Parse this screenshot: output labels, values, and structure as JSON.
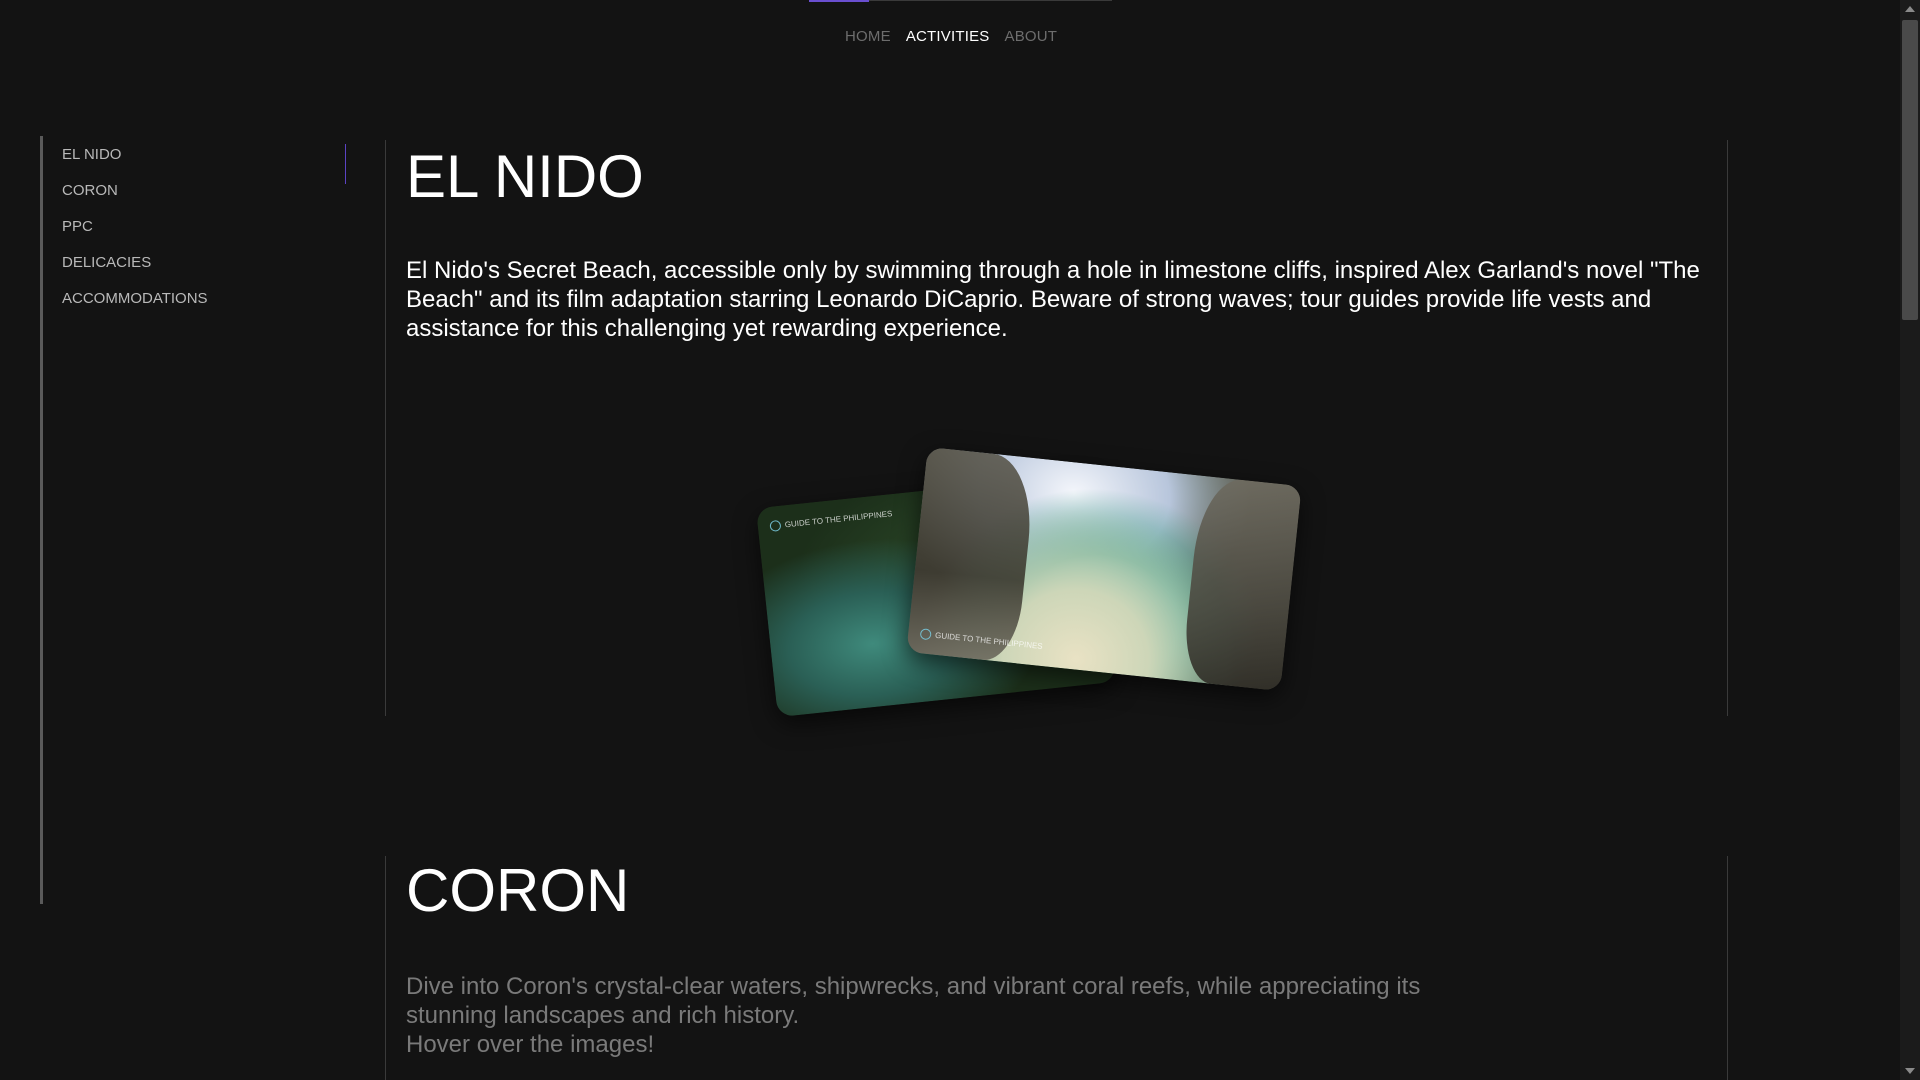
{
  "topnav": {
    "items": [
      {
        "label": "HOME"
      },
      {
        "label": "ACTIVITIES"
      },
      {
        "label": "ABOUT"
      }
    ],
    "active": "ACTIVITIES",
    "colors": {
      "active": "#ffffff",
      "inactive": "#6d6d6d",
      "indicator": "#6a4fd0"
    }
  },
  "sidebar": {
    "items": [
      {
        "label": "EL NIDO"
      },
      {
        "label": "CORON"
      },
      {
        "label": "PPC"
      },
      {
        "label": "DELICACIES"
      },
      {
        "label": "ACCOMMODATIONS"
      }
    ],
    "active": "EL NIDO"
  },
  "sections": {
    "elnido": {
      "title": "EL NIDO",
      "text": "El Nido's Secret Beach, accessible only by swimming through a hole in limestone cliffs, inspired Alex Garland's novel \"The Beach\" and its film adaptation starring Leonardo DiCaprio. Beware of strong waves; tour guides provide life vests and assistance for this challenging yet rewarding experience.",
      "photos": [
        {
          "icon": "lagoon-photo",
          "watermark": "GUIDE TO THE PHILIPPINES"
        },
        {
          "icon": "secret-beach-photo",
          "watermark": "GUIDE TO THE PHILIPPINES"
        }
      ]
    },
    "coron": {
      "title": "CORON",
      "text": "Dive into Coron's crystal-clear waters, shipwrecks, and vibrant coral reefs, while appreciating its stunning landscapes and rich history.",
      "hint": "Hover over the images!"
    }
  },
  "theme": {
    "background": "#131313",
    "text": "#ffffff",
    "muted": "#7a7a7a",
    "accent": "#5b43c4"
  }
}
